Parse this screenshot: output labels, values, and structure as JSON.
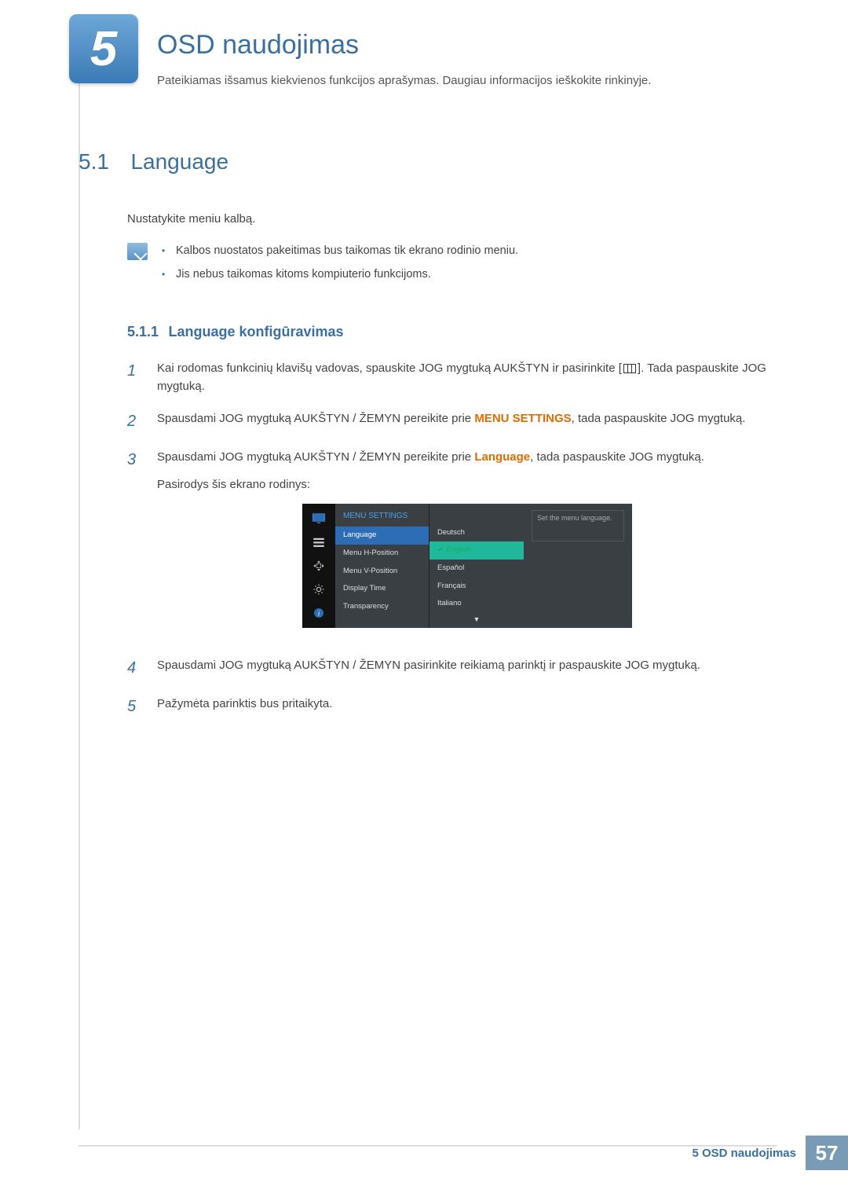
{
  "chapter": {
    "number": "5",
    "title": "OSD naudojimas",
    "description": "Pateikiamas išsamus kiekvienos funkcijos aprašymas. Daugiau informacijos ieškokite rinkinyje."
  },
  "section": {
    "number": "5.1",
    "title": "Language",
    "description": "Nustatykite meniu kalbą.",
    "notes": [
      "Kalbos nuostatos pakeitimas bus taikomas tik ekrano rodinio meniu.",
      "Jis nebus taikomas kitoms kompiuterio funkcijoms."
    ]
  },
  "subsection": {
    "number": "5.1.1",
    "title": "Language konfigūravimas"
  },
  "steps": {
    "s1a": "Kai rodomas funkcinių klavišų vadovas, spauskite JOG mygtuką AUKŠTYN ir pasirinkite [",
    "s1b": "]. Tada paspauskite JOG mygtuką.",
    "s2a": "Spausdami JOG mygtuką AUKŠTYN / ŽEMYN pereikite prie ",
    "s2hl": "MENU SETTINGS",
    "s2b": ", tada paspauskite JOG mygtuką.",
    "s3a": "Spausdami JOG mygtuką AUKŠTYN / ŽEMYN pereikite prie ",
    "s3hl": "Language",
    "s3b": ", tada paspauskite JOG mygtuką.",
    "s3c": "Pasirodys šis ekrano rodinys:",
    "s4": "Spausdami JOG mygtuką AUKŠTYN / ŽEMYN pasirinkite reikiamą parinktį ir paspauskite JOG mygtuką.",
    "s5": "Pažymėta parinktis bus pritaikyta."
  },
  "osd": {
    "header": "MENU SETTINGS",
    "items": [
      "Language",
      "Menu H-Position",
      "Menu V-Position",
      "Display Time",
      "Transparency"
    ],
    "options": [
      "Deutsch",
      "English",
      "Español",
      "Français",
      "Italiano"
    ],
    "hint": "Set the menu language."
  },
  "footer": {
    "text": "5 OSD naudojimas",
    "page": "57"
  }
}
